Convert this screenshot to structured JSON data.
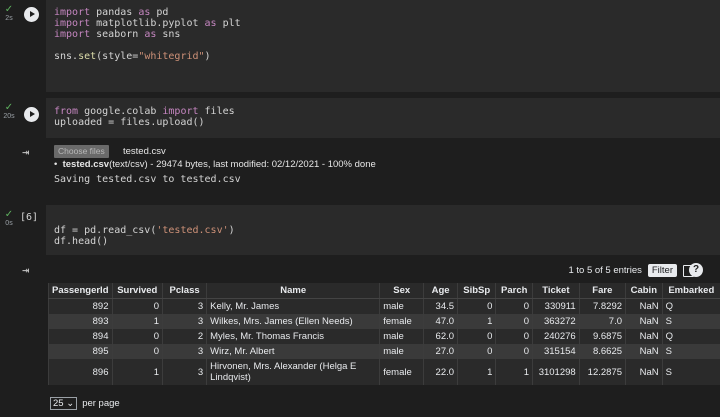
{
  "cells": [
    {
      "time": "2s",
      "code": [
        "import pandas as pd",
        "import matplotlib.pyplot as plt",
        "import seaborn as sns",
        "",
        "sns.set(style=\"whitegrid\")"
      ]
    },
    {
      "time": "20s",
      "code": [
        "from google.colab import files",
        "uploaded = files.upload()"
      ],
      "output": {
        "choose_label": "Choose files",
        "file_name": "tested.csv",
        "upload_file": "tested.csv",
        "upload_meta": "(text/csv) - 29474 bytes, last modified: 02/12/2021 - 100% done",
        "saving": "Saving tested.csv to tested.csv"
      }
    },
    {
      "time": "0s",
      "exec": "[6]",
      "code": [
        "df = pd.read_csv('tested.csv')",
        "df.head()"
      ]
    }
  ],
  "table": {
    "entries_label": "1 to 5 of 5 entries",
    "filter_label": "Filter",
    "help": "?",
    "per_page_value": "25",
    "per_page_label": "per page",
    "columns": [
      "PassengerId",
      "Survived",
      "Pclass",
      "Name",
      "Sex",
      "Age",
      "SibSp",
      "Parch",
      "Ticket",
      "Fare",
      "Cabin",
      "Embarked"
    ],
    "rows": [
      [
        "892",
        "0",
        "3",
        "Kelly, Mr. James",
        "male",
        "34.5",
        "0",
        "0",
        "330911",
        "7.8292",
        "NaN",
        "Q"
      ],
      [
        "893",
        "1",
        "3",
        "Wilkes, Mrs. James (Ellen Needs)",
        "female",
        "47.0",
        "1",
        "0",
        "363272",
        "7.0",
        "NaN",
        "S"
      ],
      [
        "894",
        "0",
        "2",
        "Myles, Mr. Thomas Francis",
        "male",
        "62.0",
        "0",
        "0",
        "240276",
        "9.6875",
        "NaN",
        "Q"
      ],
      [
        "895",
        "0",
        "3",
        "Wirz, Mr. Albert",
        "male",
        "27.0",
        "0",
        "0",
        "315154",
        "8.6625",
        "NaN",
        "S"
      ],
      [
        "896",
        "1",
        "3",
        "Hirvonen, Mrs. Alexander (Helga E Lindqvist)",
        "female",
        "22.0",
        "1",
        "1",
        "3101298",
        "12.2875",
        "NaN",
        "S"
      ]
    ]
  }
}
